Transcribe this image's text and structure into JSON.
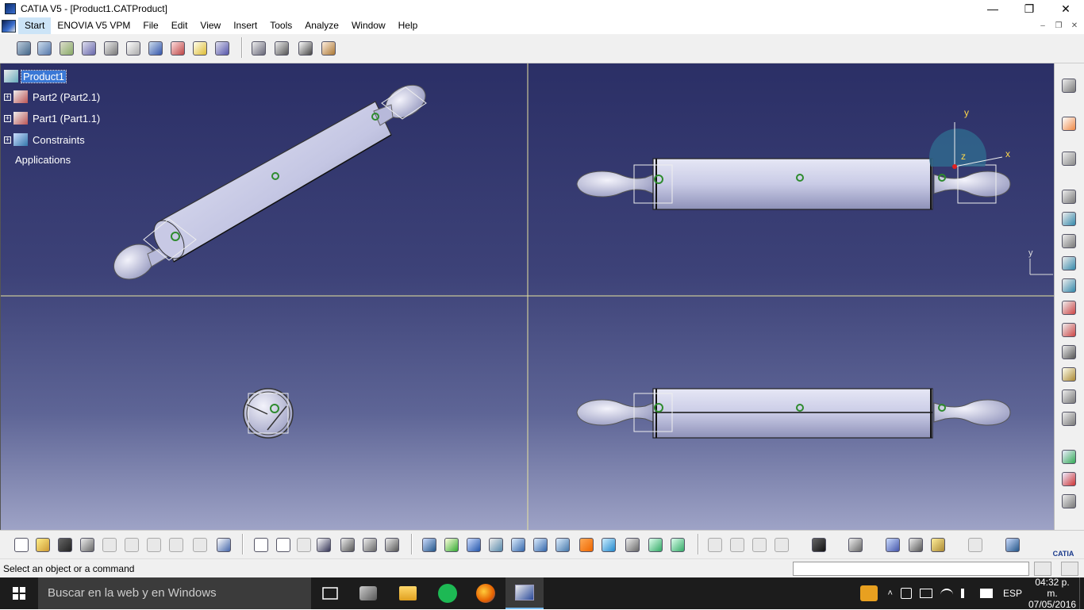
{
  "window": {
    "title": "CATIA V5 - [Product1.CATProduct]",
    "controls": {
      "minimize": "—",
      "restore": "❐",
      "close": "✕"
    }
  },
  "menu": {
    "items": [
      "Start",
      "ENOVIA V5 VPM",
      "File",
      "Edit",
      "View",
      "Insert",
      "Tools",
      "Analyze",
      "Window",
      "Help"
    ],
    "child_controls": [
      "–",
      "❐",
      "✕"
    ]
  },
  "tree": {
    "root": "Product1",
    "children": [
      {
        "label": "Part2 (Part2.1)",
        "expand": "+"
      },
      {
        "label": "Part1 (Part1.1)",
        "expand": "+"
      },
      {
        "label": "Constraints",
        "expand": "+"
      },
      {
        "label": "Applications"
      }
    ]
  },
  "viewport": {
    "compass_labels": {
      "y": "y",
      "x": "x",
      "z": "z"
    },
    "axis_label": "y",
    "colors": {
      "part": "#d4d6ee",
      "part_shadow": "#8d90b5",
      "highlight_green": "#2e8b2e",
      "divider": "#e8e3a0"
    }
  },
  "status": {
    "message": "Select an object or a command",
    "command_input": ""
  },
  "taskbar": {
    "search_placeholder": "Buscar en la web y en Windows",
    "language": "ESP",
    "time": "04:32 p. m.",
    "date": "07/05/2016",
    "tray_chevron": "˄"
  },
  "brand": {
    "catia_logo_text": "CATIA"
  }
}
